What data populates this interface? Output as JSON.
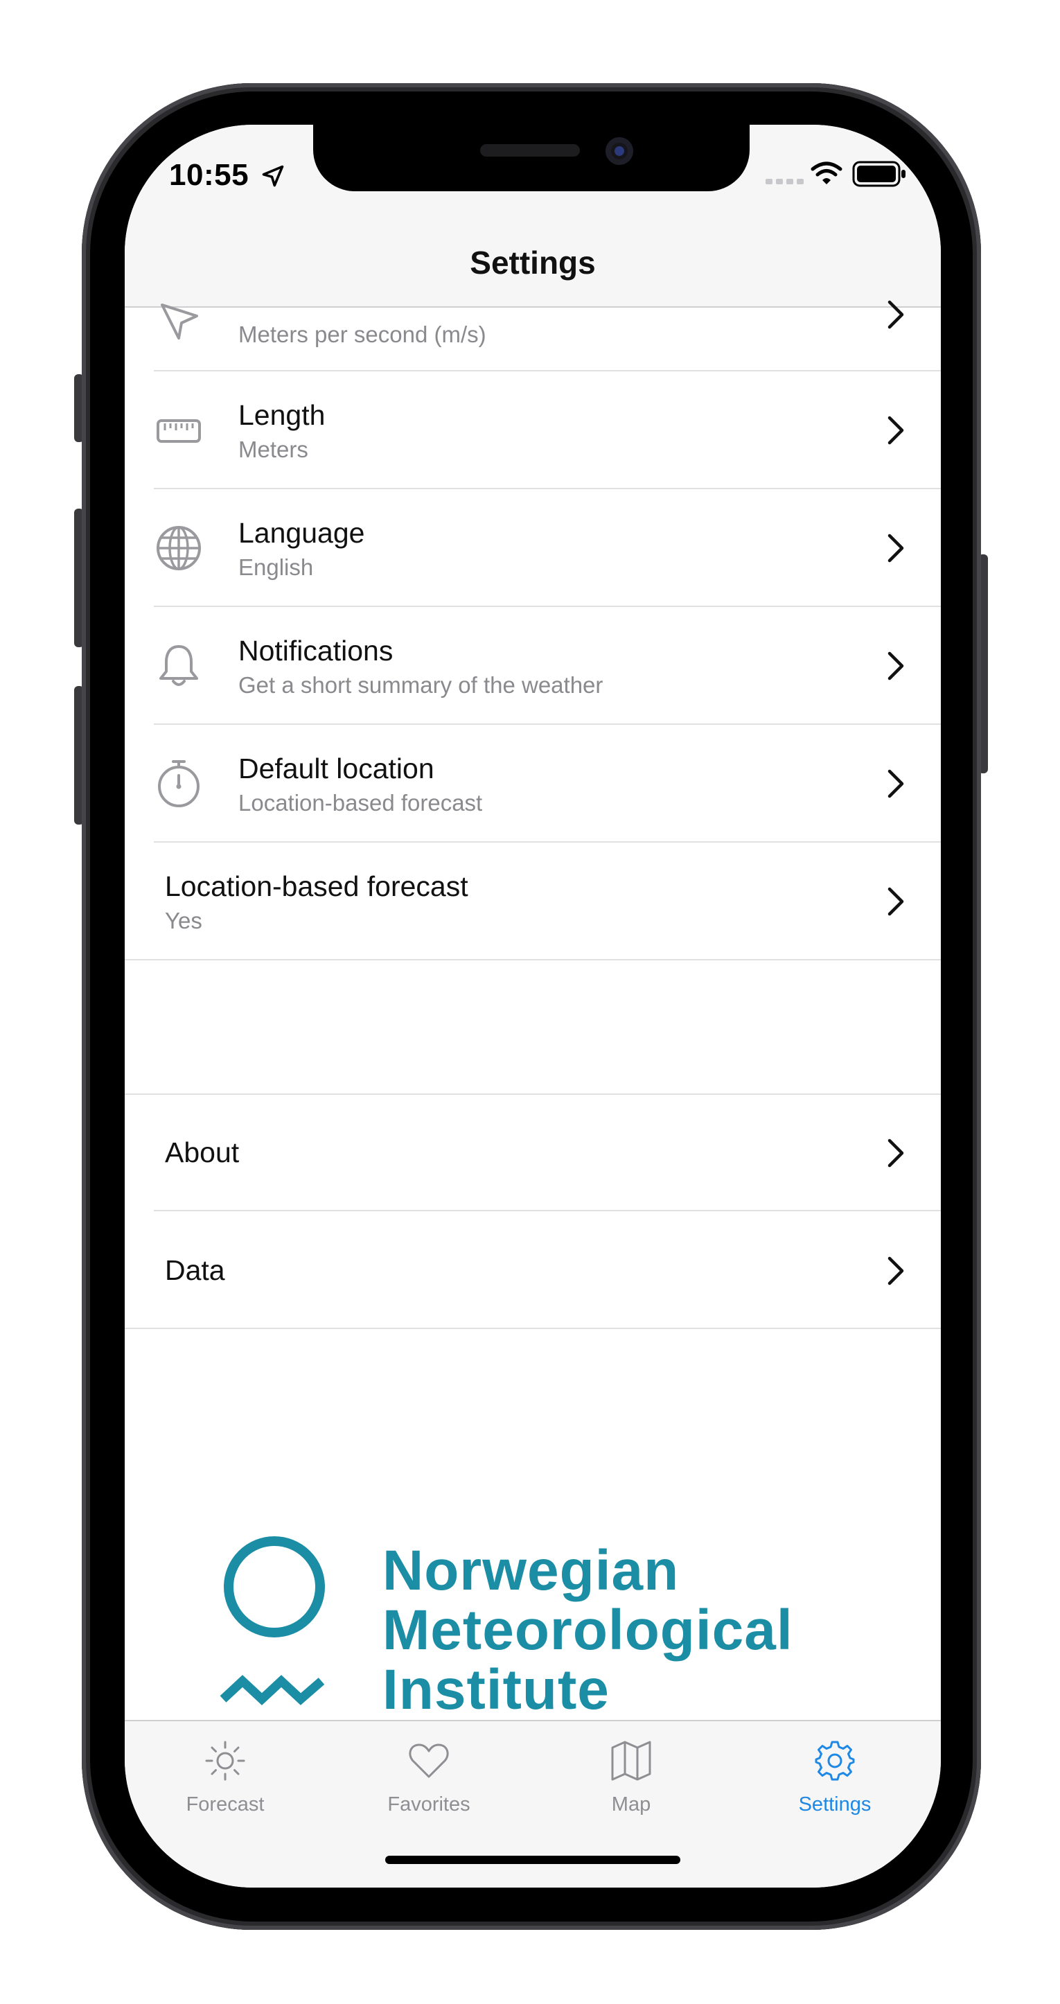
{
  "status_bar": {
    "time": "10:55"
  },
  "nav": {
    "title": "Settings"
  },
  "settings_rows": [
    {
      "icon": "wind-arrow-icon",
      "title": "",
      "subtitle": "Meters per second (m/s)"
    },
    {
      "icon": "ruler-icon",
      "title": "Length",
      "subtitle": "Meters"
    },
    {
      "icon": "globe-icon",
      "title": "Language",
      "subtitle": "English"
    },
    {
      "icon": "bell-icon",
      "title": "Notifications",
      "subtitle": "Get a short summary of the weather"
    },
    {
      "icon": "stopwatch-icon",
      "title": "Default location",
      "subtitle": "Location-based forecast"
    },
    {
      "icon": "",
      "title": "Location-based forecast",
      "subtitle": "Yes"
    }
  ],
  "info_rows": [
    {
      "title": "About"
    },
    {
      "title": "Data"
    }
  ],
  "logo": {
    "line1": "Norwegian",
    "line2": "Meteorological",
    "line3": "Institute",
    "color": "#1b8ea5"
  },
  "tabs": [
    {
      "icon": "sun-icon",
      "label": "Forecast",
      "active": false
    },
    {
      "icon": "heart-icon",
      "label": "Favorites",
      "active": false
    },
    {
      "icon": "map-icon",
      "label": "Map",
      "active": false
    },
    {
      "icon": "gear-icon",
      "label": "Settings",
      "active": true
    }
  ],
  "colors": {
    "accent": "#1e88e5",
    "secondary_text": "#8a8a8e",
    "logo": "#1b8ea5"
  }
}
